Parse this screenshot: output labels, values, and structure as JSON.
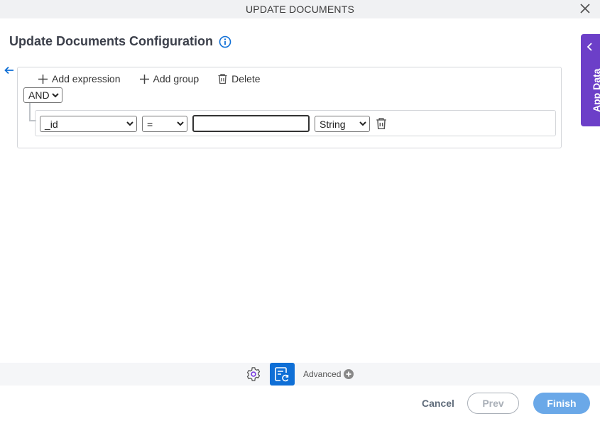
{
  "window": {
    "title": "UPDATE DOCUMENTS"
  },
  "page": {
    "heading": "Update Documents Configuration"
  },
  "toolbar": {
    "add_expression": "Add expression",
    "add_group": "Add group",
    "delete": "Delete"
  },
  "group": {
    "operator": "AND"
  },
  "expression": {
    "field": "_id",
    "comparator": "=",
    "value": "",
    "type": "String"
  },
  "side_panel": {
    "label": "App Data"
  },
  "bottom": {
    "advanced_label": "Advanced"
  },
  "footer": {
    "cancel": "Cancel",
    "prev": "Prev",
    "finish": "Finish"
  },
  "colors": {
    "accent": "#0f6fd6",
    "side_panel": "#6c3fc8",
    "finish": "#6aa8e8"
  }
}
